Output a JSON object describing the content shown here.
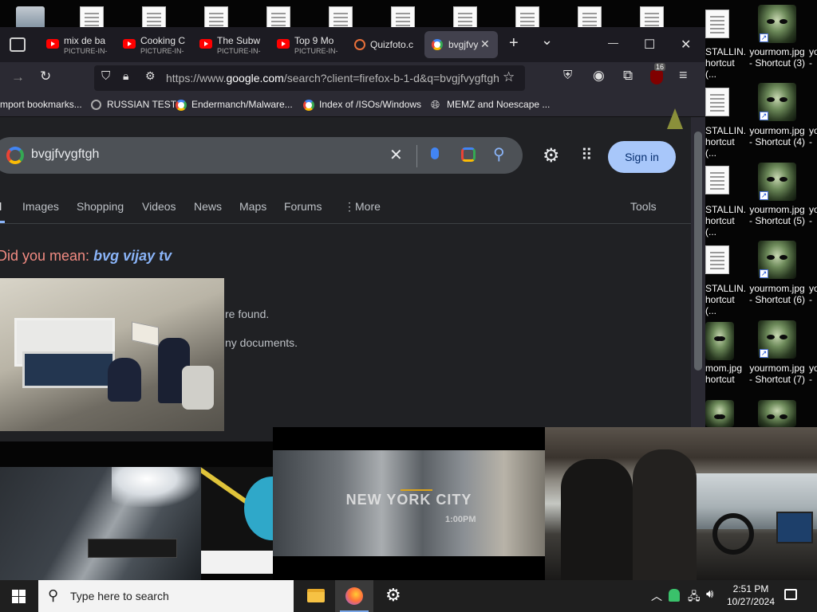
{
  "desktop": {
    "recycle_bin": "",
    "right_icons": [
      {
        "line1": "STALLIN...",
        "line2": "hortcut (..."
      },
      {
        "line1": "yourmom.jpg",
        "line2": "- Shortcut (3)"
      },
      {
        "line1": "yo",
        "line2": "-"
      },
      {
        "line1": "STALLIN...",
        "line2": "hortcut (..."
      },
      {
        "line1": "yourmom.jpg",
        "line2": "- Shortcut (4)"
      },
      {
        "line1": "yo",
        "line2": "-"
      },
      {
        "line1": "STALLIN...",
        "line2": "hortcut (..."
      },
      {
        "line1": "yourmom.jpg",
        "line2": "- Shortcut (5)"
      },
      {
        "line1": "yo",
        "line2": "-"
      },
      {
        "line1": "STALLIN...",
        "line2": "hortcut (..."
      },
      {
        "line1": "yourmom.jpg",
        "line2": "- Shortcut (6)"
      },
      {
        "line1": "yo",
        "line2": "-"
      },
      {
        "line1": "mom.jpg",
        "line2": "hortcut"
      },
      {
        "line1": "yourmom.jpg",
        "line2": "- Shortcut (7)"
      },
      {
        "line1": "yo",
        "line2": "-"
      }
    ]
  },
  "browser": {
    "tabs": [
      {
        "title": "mix de ba",
        "subtitle": "PICTURE-IN-"
      },
      {
        "title": "Cooking C",
        "subtitle": "PICTURE-IN-"
      },
      {
        "title": "The Subw",
        "subtitle": "PICTURE-IN-"
      },
      {
        "title": "Top 9 Mo",
        "subtitle": "PICTURE-IN-"
      },
      {
        "title": "Quizfoto.c"
      },
      {
        "title": "bvgjfvy"
      }
    ],
    "new_tab": "+",
    "tab_list": "⌄",
    "window_controls": {
      "minimize": "—",
      "maximize": "☐",
      "close": "✕"
    },
    "url_prefix": "https://www.",
    "url_domain": "google.com",
    "url_rest": "/search?client=firefox-b-1-d&q=bvgjfvygftgh",
    "extension_badge": "16",
    "bookmarks": [
      "mport bookmarks...",
      "RUSSIAN TEST",
      "Endermanch/Malware...",
      "Index of /ISOs/Windows",
      "MEMZ and Noescape ..."
    ]
  },
  "google": {
    "query": "bvgjfvygftgh",
    "sign_in": "Sign in",
    "tabs": [
      "ll",
      "Images",
      "Shopping",
      "Videos",
      "News",
      "Maps",
      "Forums",
      "More",
      "Tools"
    ],
    "did_you_mean_label": "Did you mean:",
    "did_you_mean_value": "bvg vijay tv",
    "result_line1": "re found.",
    "result_line2": "ny documents."
  },
  "video_overlay": {
    "ny_title": "NEW YORK CITY",
    "ny_time": "1:00PM"
  },
  "taskbar": {
    "search_placeholder": "Type here to search",
    "time": "2:51 PM",
    "date": "10/27/2024"
  },
  "colors": {
    "page_bg": "#202124",
    "accent_signin": "#a8c7fa",
    "did_you_mean": "#f28b82",
    "link": "#8ab4f8",
    "taskbar": "#1f1f1f"
  }
}
